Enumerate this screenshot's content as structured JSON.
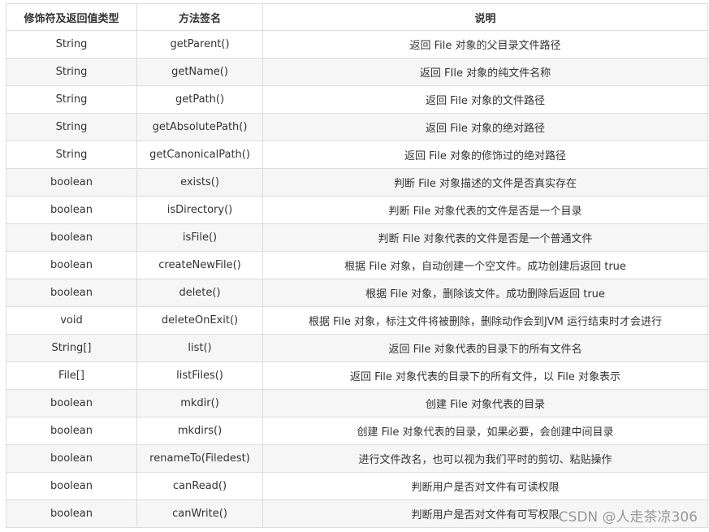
{
  "table": {
    "headers": [
      "修饰符及返回值类型",
      "方法签名",
      "说明"
    ],
    "rows": [
      [
        "String",
        "getParent()",
        "返回 File 对象的父目录文件路径"
      ],
      [
        "String",
        "getName()",
        "返回 FIle 对象的纯文件名称"
      ],
      [
        "String",
        "getPath()",
        "返回 File 对象的文件路径"
      ],
      [
        "String",
        "getAbsolutePath()",
        "返回 File 对象的绝对路径"
      ],
      [
        "String",
        "getCanonicalPath()",
        "返回 File 对象的修饰过的绝对路径"
      ],
      [
        "boolean",
        "exists()",
        "判断 File 对象描述的文件是否真实存在"
      ],
      [
        "boolean",
        "isDirectory()",
        "判断 File 对象代表的文件是否是一个目录"
      ],
      [
        "boolean",
        "isFile()",
        "判断 File 对象代表的文件是否是一个普通文件"
      ],
      [
        "boolean",
        "createNewFile()",
        "根据 File 对象，自动创建一个空文件。成功创建后返回 true"
      ],
      [
        "boolean",
        "delete()",
        "根据 File 对象，删除该文件。成功删除后返回 true"
      ],
      [
        "void",
        "deleteOnExit()",
        "根据 File 对象，标注文件将被删除，删除动作会到JVM 运行结束时才会进行"
      ],
      [
        "String[]",
        "list()",
        "返回 File 对象代表的目录下的所有文件名"
      ],
      [
        "File[]",
        "listFiles()",
        "返回 File 对象代表的目录下的所有文件，以 File 对象表示"
      ],
      [
        "boolean",
        "mkdir()",
        "创建 File 对象代表的目录"
      ],
      [
        "boolean",
        "mkdirs()",
        "创建 File 对象代表的目录，如果必要，会创建中间目录"
      ],
      [
        "boolean",
        "renameTo(Filedest)",
        "进行文件改名，也可以视为我们平时的剪切、粘贴操作"
      ],
      [
        "boolean",
        "canRead()",
        "判断用户是否对文件有可读权限"
      ],
      [
        "boolean",
        "canWrite()",
        "判断用户是否对文件有可写权限"
      ]
    ]
  },
  "watermark": {
    "text": "CSDN @人走茶凉306"
  }
}
